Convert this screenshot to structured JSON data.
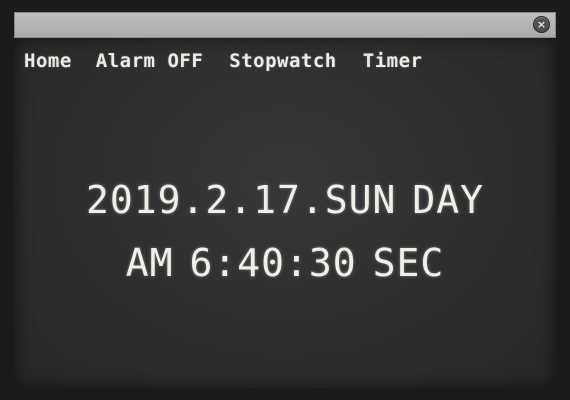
{
  "window": {
    "close_glyph": "×"
  },
  "nav": {
    "home": "Home",
    "alarm": "Alarm",
    "alarm_state": "OFF",
    "stopwatch": "Stopwatch",
    "timer": "Timer"
  },
  "clock": {
    "date": "2019.2.17.SUN",
    "day_label": "DAY",
    "meridiem": "AM",
    "time": "6:40:30",
    "sec_label": "SEC"
  },
  "colors": {
    "background": "#2e2e2e",
    "text": "#f1f0e8",
    "titlebar": "#b5b5b5"
  }
}
